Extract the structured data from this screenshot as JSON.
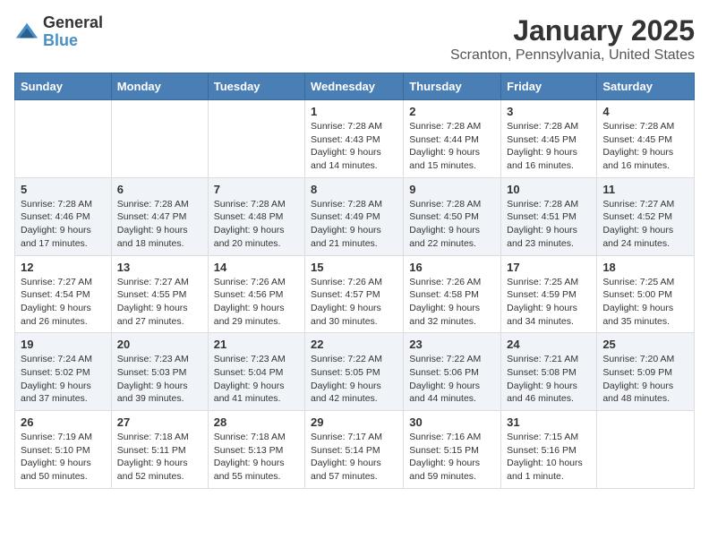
{
  "logo": {
    "general": "General",
    "blue": "Blue"
  },
  "title": "January 2025",
  "subtitle": "Scranton, Pennsylvania, United States",
  "headers": [
    "Sunday",
    "Monday",
    "Tuesday",
    "Wednesday",
    "Thursday",
    "Friday",
    "Saturday"
  ],
  "weeks": [
    [
      {
        "day": "",
        "info": ""
      },
      {
        "day": "",
        "info": ""
      },
      {
        "day": "",
        "info": ""
      },
      {
        "day": "1",
        "info": "Sunrise: 7:28 AM\nSunset: 4:43 PM\nDaylight: 9 hours\nand 14 minutes."
      },
      {
        "day": "2",
        "info": "Sunrise: 7:28 AM\nSunset: 4:44 PM\nDaylight: 9 hours\nand 15 minutes."
      },
      {
        "day": "3",
        "info": "Sunrise: 7:28 AM\nSunset: 4:45 PM\nDaylight: 9 hours\nand 16 minutes."
      },
      {
        "day": "4",
        "info": "Sunrise: 7:28 AM\nSunset: 4:45 PM\nDaylight: 9 hours\nand 16 minutes."
      }
    ],
    [
      {
        "day": "5",
        "info": "Sunrise: 7:28 AM\nSunset: 4:46 PM\nDaylight: 9 hours\nand 17 minutes."
      },
      {
        "day": "6",
        "info": "Sunrise: 7:28 AM\nSunset: 4:47 PM\nDaylight: 9 hours\nand 18 minutes."
      },
      {
        "day": "7",
        "info": "Sunrise: 7:28 AM\nSunset: 4:48 PM\nDaylight: 9 hours\nand 20 minutes."
      },
      {
        "day": "8",
        "info": "Sunrise: 7:28 AM\nSunset: 4:49 PM\nDaylight: 9 hours\nand 21 minutes."
      },
      {
        "day": "9",
        "info": "Sunrise: 7:28 AM\nSunset: 4:50 PM\nDaylight: 9 hours\nand 22 minutes."
      },
      {
        "day": "10",
        "info": "Sunrise: 7:28 AM\nSunset: 4:51 PM\nDaylight: 9 hours\nand 23 minutes."
      },
      {
        "day": "11",
        "info": "Sunrise: 7:27 AM\nSunset: 4:52 PM\nDaylight: 9 hours\nand 24 minutes."
      }
    ],
    [
      {
        "day": "12",
        "info": "Sunrise: 7:27 AM\nSunset: 4:54 PM\nDaylight: 9 hours\nand 26 minutes."
      },
      {
        "day": "13",
        "info": "Sunrise: 7:27 AM\nSunset: 4:55 PM\nDaylight: 9 hours\nand 27 minutes."
      },
      {
        "day": "14",
        "info": "Sunrise: 7:26 AM\nSunset: 4:56 PM\nDaylight: 9 hours\nand 29 minutes."
      },
      {
        "day": "15",
        "info": "Sunrise: 7:26 AM\nSunset: 4:57 PM\nDaylight: 9 hours\nand 30 minutes."
      },
      {
        "day": "16",
        "info": "Sunrise: 7:26 AM\nSunset: 4:58 PM\nDaylight: 9 hours\nand 32 minutes."
      },
      {
        "day": "17",
        "info": "Sunrise: 7:25 AM\nSunset: 4:59 PM\nDaylight: 9 hours\nand 34 minutes."
      },
      {
        "day": "18",
        "info": "Sunrise: 7:25 AM\nSunset: 5:00 PM\nDaylight: 9 hours\nand 35 minutes."
      }
    ],
    [
      {
        "day": "19",
        "info": "Sunrise: 7:24 AM\nSunset: 5:02 PM\nDaylight: 9 hours\nand 37 minutes."
      },
      {
        "day": "20",
        "info": "Sunrise: 7:23 AM\nSunset: 5:03 PM\nDaylight: 9 hours\nand 39 minutes."
      },
      {
        "day": "21",
        "info": "Sunrise: 7:23 AM\nSunset: 5:04 PM\nDaylight: 9 hours\nand 41 minutes."
      },
      {
        "day": "22",
        "info": "Sunrise: 7:22 AM\nSunset: 5:05 PM\nDaylight: 9 hours\nand 42 minutes."
      },
      {
        "day": "23",
        "info": "Sunrise: 7:22 AM\nSunset: 5:06 PM\nDaylight: 9 hours\nand 44 minutes."
      },
      {
        "day": "24",
        "info": "Sunrise: 7:21 AM\nSunset: 5:08 PM\nDaylight: 9 hours\nand 46 minutes."
      },
      {
        "day": "25",
        "info": "Sunrise: 7:20 AM\nSunset: 5:09 PM\nDaylight: 9 hours\nand 48 minutes."
      }
    ],
    [
      {
        "day": "26",
        "info": "Sunrise: 7:19 AM\nSunset: 5:10 PM\nDaylight: 9 hours\nand 50 minutes."
      },
      {
        "day": "27",
        "info": "Sunrise: 7:18 AM\nSunset: 5:11 PM\nDaylight: 9 hours\nand 52 minutes."
      },
      {
        "day": "28",
        "info": "Sunrise: 7:18 AM\nSunset: 5:13 PM\nDaylight: 9 hours\nand 55 minutes."
      },
      {
        "day": "29",
        "info": "Sunrise: 7:17 AM\nSunset: 5:14 PM\nDaylight: 9 hours\nand 57 minutes."
      },
      {
        "day": "30",
        "info": "Sunrise: 7:16 AM\nSunset: 5:15 PM\nDaylight: 9 hours\nand 59 minutes."
      },
      {
        "day": "31",
        "info": "Sunrise: 7:15 AM\nSunset: 5:16 PM\nDaylight: 10 hours\nand 1 minute."
      },
      {
        "day": "",
        "info": ""
      }
    ]
  ]
}
